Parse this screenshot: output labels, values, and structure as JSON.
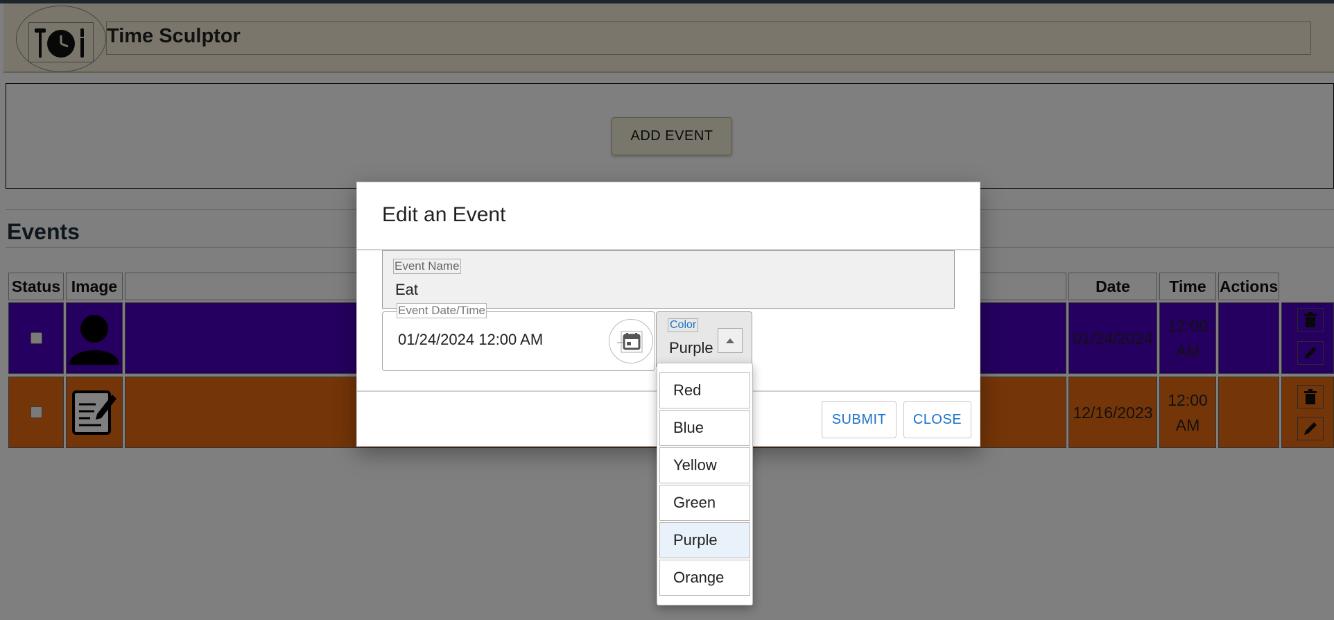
{
  "app": {
    "title": "Time Sculptor"
  },
  "toolbar": {
    "add_event_label": "ADD EVENT"
  },
  "events": {
    "heading": "Events",
    "columns": {
      "status": "Status",
      "image": "Image",
      "date": "Date",
      "time": "Time",
      "actions": "Actions"
    },
    "rows": [
      {
        "color": "#4a00c0",
        "date": "01/24/2024",
        "time_line1": "12:00",
        "time_line2": "AM",
        "image": "person-icon"
      },
      {
        "color": "#e86a10",
        "date": "12/16/2023",
        "time_line1": "12:00",
        "time_line2": "AM",
        "image": "edit-document-icon"
      }
    ]
  },
  "dialog": {
    "title": "Edit an Event",
    "event_name": {
      "label": "Event Name",
      "value": "Eat"
    },
    "event_datetime": {
      "label": "Event Date/Time",
      "value": "01/24/2024 12:00 AM"
    },
    "color": {
      "label": "Color",
      "value": "Purple"
    },
    "color_options": [
      "Red",
      "Blue",
      "Yellow",
      "Green",
      "Purple",
      "Orange"
    ],
    "submit_label": "SUBMIT",
    "close_label": "CLOSE"
  }
}
